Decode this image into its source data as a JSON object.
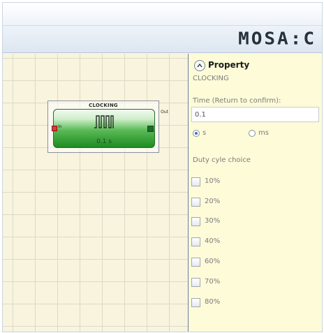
{
  "app": {
    "logo": "MOSA:C"
  },
  "diagram": {
    "block": {
      "title": "CLOCKING",
      "input_label": "In",
      "output_label": "Out",
      "value": "0.1 s"
    }
  },
  "property": {
    "title": "Property",
    "subtitle": "CLOCKING",
    "time_label": "Time (Return to confirm):",
    "time_value": "0.1",
    "unit_options": [
      {
        "label": "s",
        "selected": true
      },
      {
        "label": "ms",
        "selected": false
      }
    ],
    "duty_label": "Duty cyle choice",
    "duty_options": [
      "10%",
      "20%",
      "30%",
      "40%",
      "60%",
      "70%",
      "80%"
    ]
  }
}
